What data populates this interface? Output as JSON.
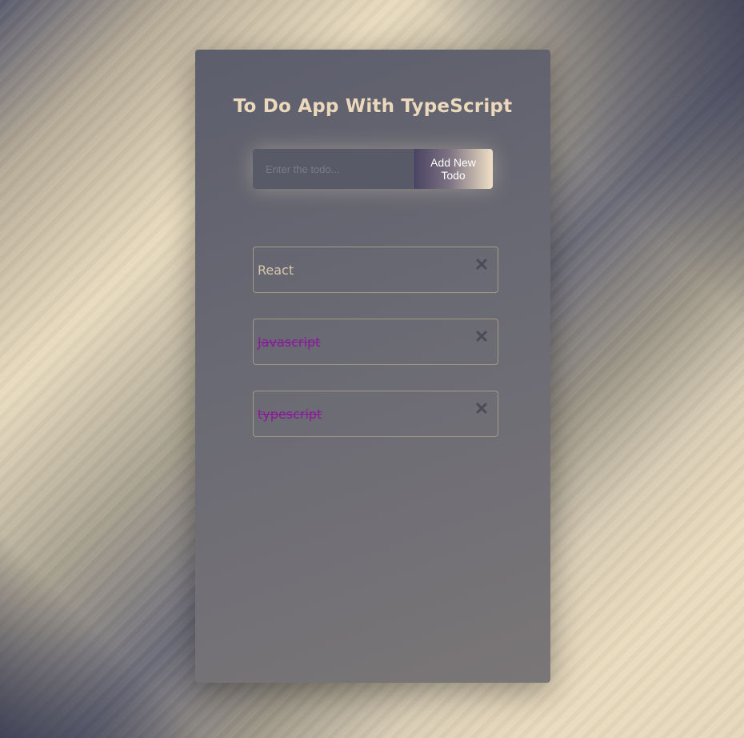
{
  "app": {
    "title": "To Do App With TypeScript"
  },
  "form": {
    "input_placeholder": "Enter the todo...",
    "input_value": "",
    "add_button_label": "Add New Todo"
  },
  "todos": [
    {
      "text": "React",
      "completed": false,
      "delete_icon": "close-icon"
    },
    {
      "text": "Javascript",
      "completed": true,
      "delete_icon": "close-icon"
    },
    {
      "text": "typescript",
      "completed": true,
      "delete_icon": "close-icon"
    }
  ],
  "colors": {
    "title": "#ecd9bb",
    "completed_text": "#8a1a9a",
    "active_text": "#d8c7aa",
    "item_border": "#a39a84"
  }
}
